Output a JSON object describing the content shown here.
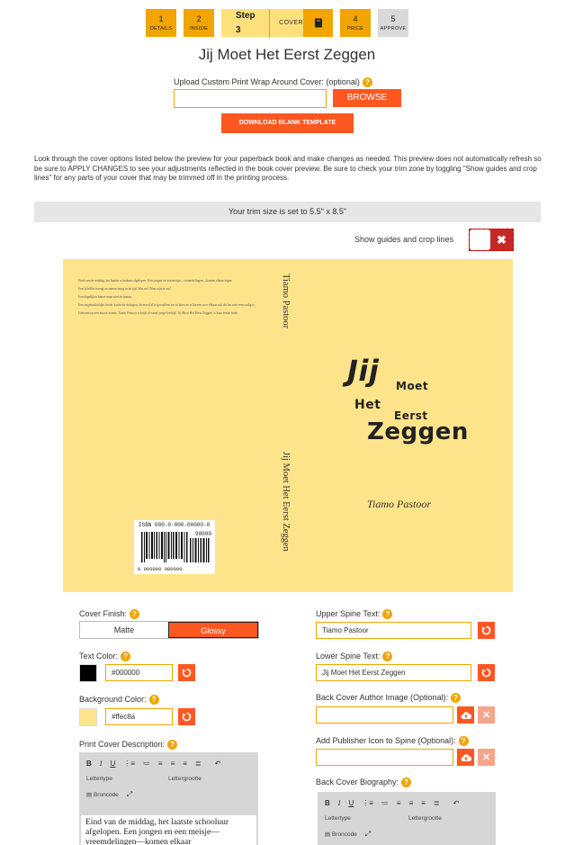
{
  "steps": [
    {
      "num": "1",
      "label": "DETAILS"
    },
    {
      "num": "2",
      "label": "INSIDE"
    },
    {
      "current_label": "Step 3",
      "current_name": "COVER"
    },
    {
      "num": "4",
      "label": "PRICE"
    },
    {
      "num": "5",
      "label": "APPROVE"
    }
  ],
  "book_title": "Jij Moet Het Eerst Zeggen",
  "upload": {
    "label": "Upload Custom Print Wrap Around Cover: (optional)",
    "browse_label": "BROWSE",
    "download_label": "DOWNLOAD BLANK TEMPLATE"
  },
  "intro_text": "Look through the cover options listed below the preview for your paperback book and make changes as needed. This preview does not automatically refresh so be sure to APPLY CHANGES to see your adjustments reflected in the book cover preview. Be sure to check your trim zone by toggling \"Show guides and crop lines\" for any parts of your cover that may be trimmed off in the printing process.",
  "trim_text": "Your trim size is set to 5.5\" x 8.5\"",
  "guides_label": "Show guides and crop lines",
  "cover_preview": {
    "bg_color": "#fde48a",
    "back_paragraphs": [
      "Eind van de middag, het laatste schooluur afgelopen. Een jongen en een meisje—vreemdelingen—komen elkaar tegen.",
      "Een lichtflits brengt ze samen terug in de tijd. Wat nu? Waar zijn ze nu?",
      "Een dagelijkse keuze maar niet de laatste.",
      "Een ongebruikelijke liefde, kritische dialogen, de moed al je gevoelens toe te laten en te kiezen voor elkaar ook als het niet eenvoudig is.",
      "Geboren op een mooie zomer, Tiamo Pastoor schrijft al vanaf jonge leeftijd. 'Jij Moet Het Eerst Zeggen' is haar eerste boek."
    ],
    "isbn": "ISBN 000-0-000-00000-0",
    "barcode_price": "90000",
    "barcode_number": "0 000000 000000",
    "spine_upper": "Tiamo Pastoor",
    "spine_lower": "Jij Moet Het Eerst Zeggen",
    "front_title_words": [
      "Jij",
      "Moet",
      "Het",
      "Eerst",
      "Zeggen"
    ],
    "front_author": "Tiamo Pastoor"
  },
  "form": {
    "cover_finish_label": "Cover Finish:",
    "finish_options": [
      "Matte",
      "Glossy"
    ],
    "finish_selected": "Glossy",
    "text_color_label": "Text Color:",
    "text_color": "#000000",
    "bg_color_label": "Background Color:",
    "bg_color": "#ffec8a",
    "bg_color_swatch": "#fde48a",
    "print_desc_label": "Print Cover Description:",
    "upper_spine_label": "Upper Spine Text:",
    "upper_spine_value": "Tiamo Pastoor",
    "lower_spine_label": "Lower Spine Text:",
    "lower_spine_value": "Jij Moet Het Eerst Zeggen",
    "author_image_label": "Back Cover Author Image (Optional):",
    "publisher_icon_label": "Add Publisher Icon to Spine (Optional):",
    "biography_label": "Back Cover Biography:"
  },
  "editor": {
    "font_type_placeholder": "Lettertype",
    "font_size_placeholder": "Lettergrootte",
    "source_label": "Broncode",
    "desc_text": "Eind van de middag, het laatste schooluur afgelopen. Een jongen en een meisje—vreemdelingen—komen elkaar"
  },
  "colors": {
    "accent": "#ff5722",
    "step": "#f0a500"
  }
}
